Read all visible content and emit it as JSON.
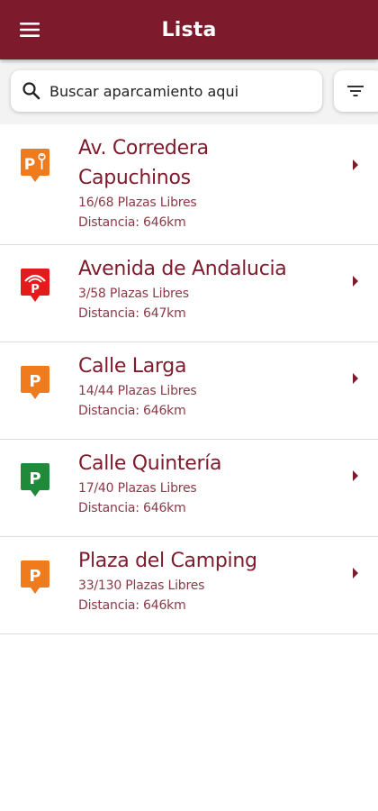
{
  "header": {
    "title": "Lista",
    "menu_icon": "menu-icon",
    "background_color": "#7d1b2c"
  },
  "search": {
    "placeholder": "Buscar aparcamiento aqui",
    "value": "",
    "search_icon": "search-icon",
    "filter_icon": "filter-icon"
  },
  "colors": {
    "accent": "#7d1b2c",
    "marker_orange": "#f07b1d",
    "marker_red": "#e41b1b",
    "marker_green": "#1f8a3a"
  },
  "parkings": [
    {
      "name_line1": "Av. Corredera",
      "name_line2": "Capuchinos",
      "spaces": "16/68 Plazas Libres",
      "distance": "Distancia: 646km",
      "marker": "parking-electric-icon"
    },
    {
      "name": "Avenida de Andalucia",
      "spaces": "3/58 Plazas Libres",
      "distance": "Distancia: 647km",
      "marker": "parking-covered-icon"
    },
    {
      "name": "Calle Larga",
      "spaces": "14/44 Plazas Libres",
      "distance": "Distancia: 646km",
      "marker": "parking-icon"
    },
    {
      "name": "Calle Quintería",
      "spaces": "17/40 Plazas Libres",
      "distance": "Distancia: 646km",
      "marker": "parking-icon"
    },
    {
      "name": "Plaza del Camping",
      "spaces": "33/130 Plazas Libres",
      "distance": "Distancia: 646km",
      "marker": "parking-icon"
    }
  ]
}
